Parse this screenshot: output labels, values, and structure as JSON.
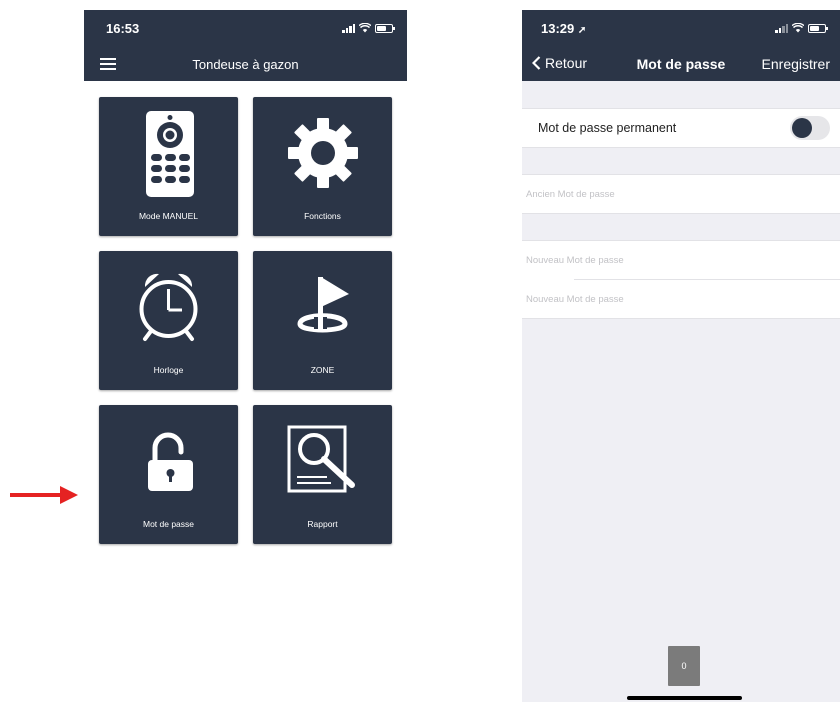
{
  "left_screen": {
    "status_time": "16:53",
    "title": "Tondeuse à gazon",
    "tiles": [
      {
        "label": "Mode MANUEL",
        "icon": "remote-control-icon"
      },
      {
        "label": "Fonctions",
        "icon": "gear-icon"
      },
      {
        "label": "Horloge",
        "icon": "alarm-clock-icon"
      },
      {
        "label": "ZONE",
        "icon": "flag-zone-icon"
      },
      {
        "label": "Mot de passe",
        "icon": "unlocked-padlock-icon"
      },
      {
        "label": "Rapport",
        "icon": "report-magnifier-icon"
      }
    ]
  },
  "right_screen": {
    "status_time": "13:29",
    "back_label": "Retour",
    "title": "Mot de passe",
    "save_label": "Enregistrer",
    "permanent_label": "Mot de passe permanent",
    "permanent_enabled": false,
    "old_password_placeholder": "Ancien Mot de passe",
    "new_password_placeholder": "Nouveau Mot de passe",
    "confirm_password_placeholder": "Nouveau Mot de passe",
    "counter_value": "0"
  },
  "colors": {
    "navy": "#2b3547",
    "arrow": "#e52222",
    "background": "#efeff4"
  }
}
